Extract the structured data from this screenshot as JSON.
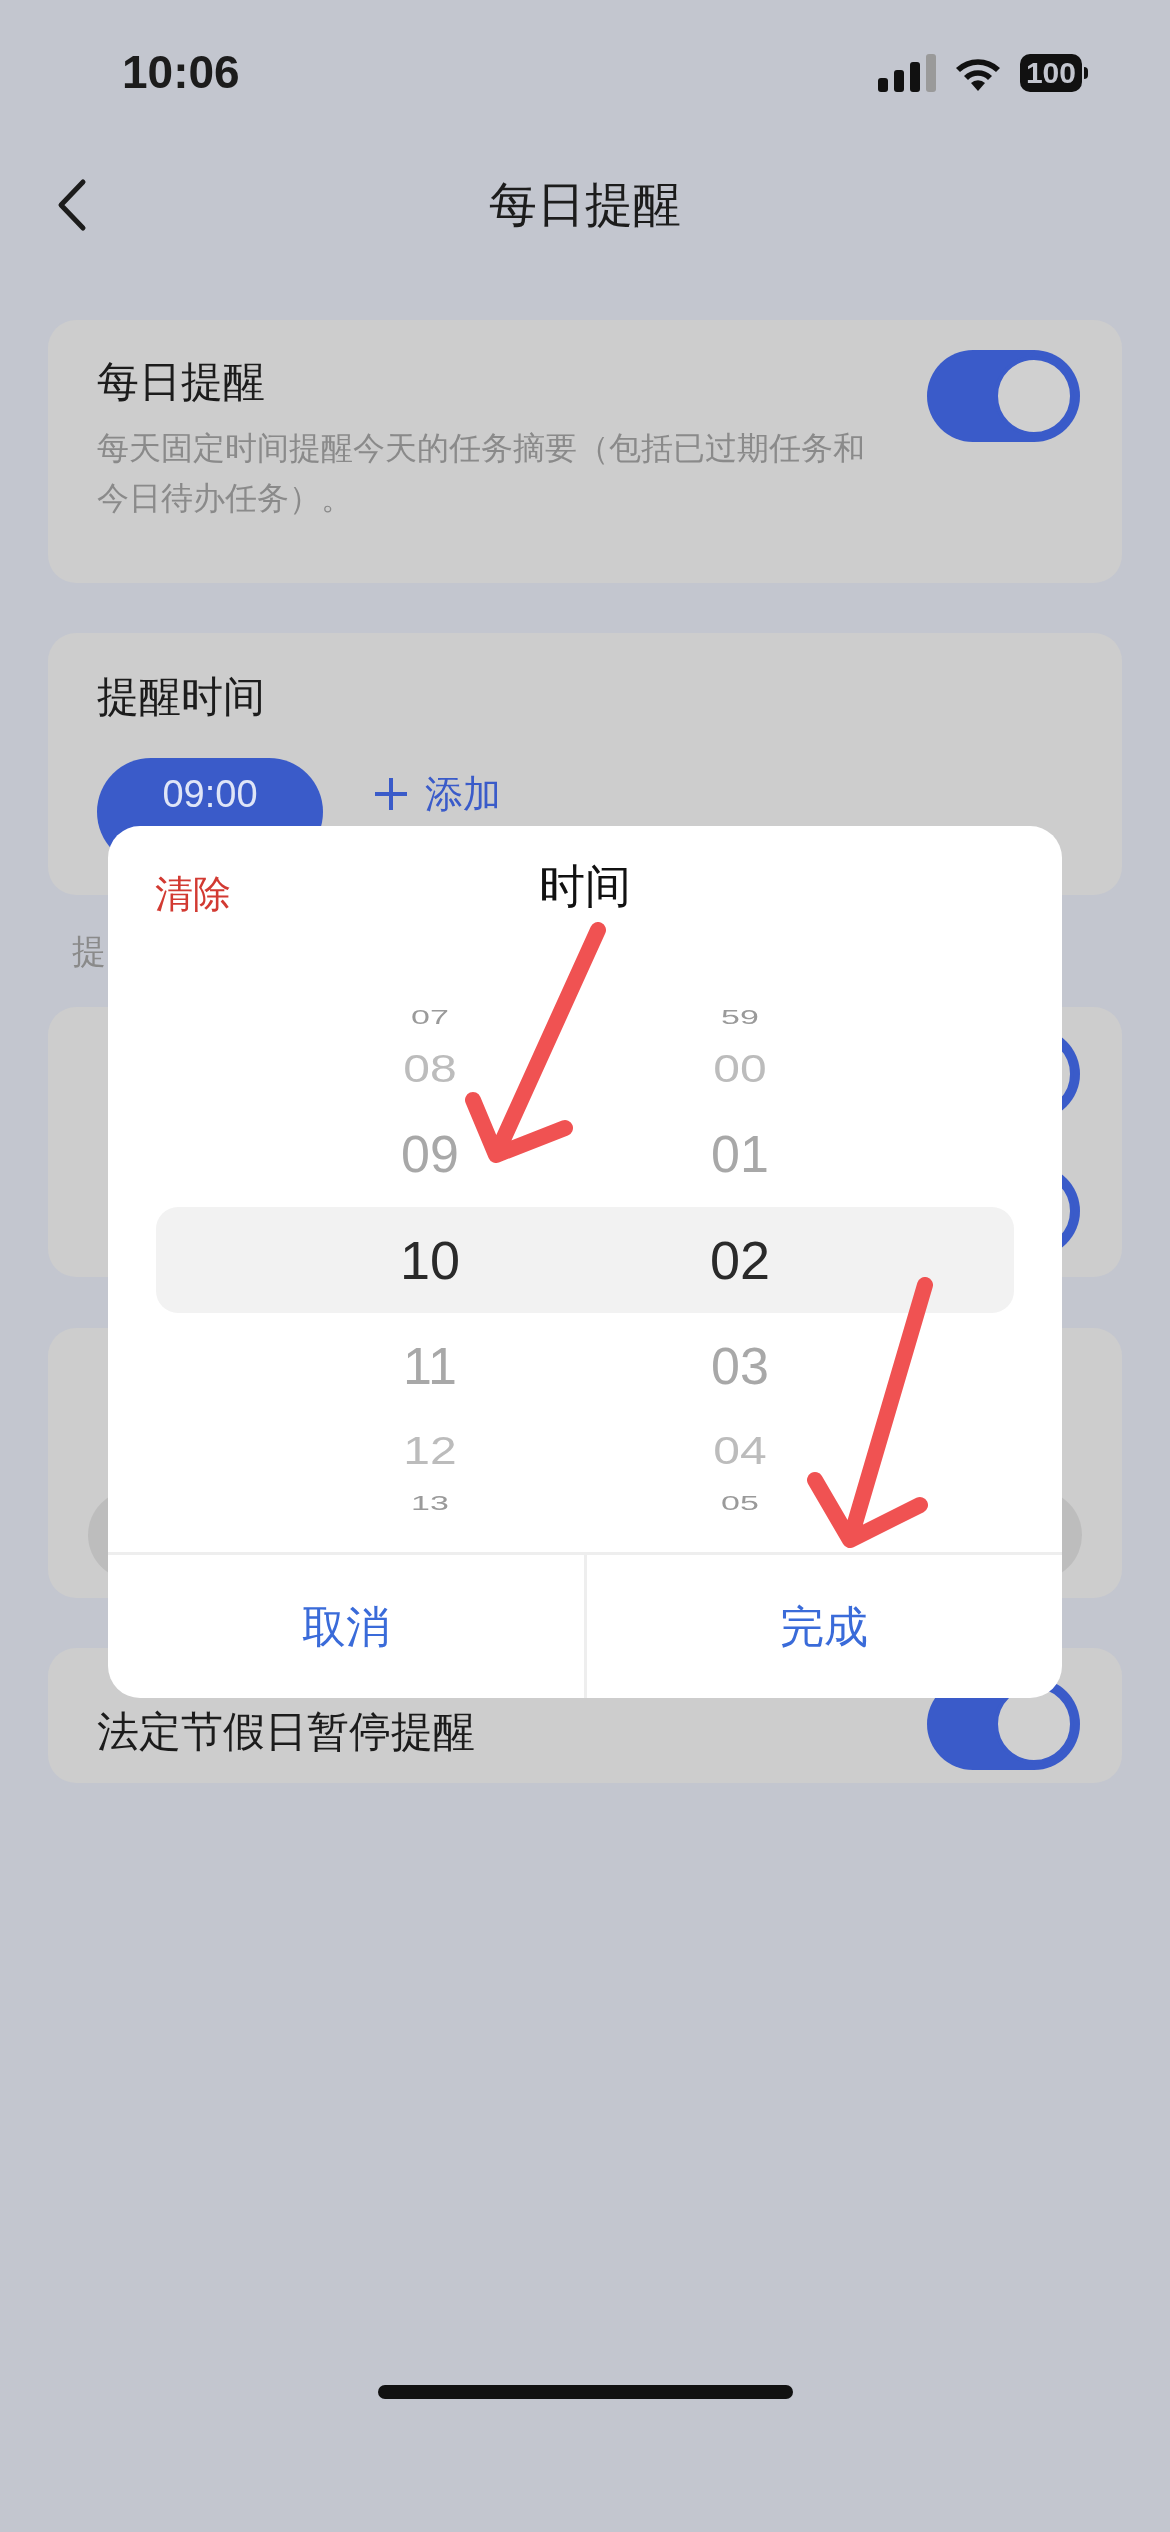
{
  "status_bar": {
    "time": "10:06",
    "battery": "100"
  },
  "header": {
    "title": "每日提醒"
  },
  "daily_reminder": {
    "title": "每日提醒",
    "description": "每天固定时间提醒今天的任务摘要（包括已过期任务和今日待办任务）。",
    "on": true
  },
  "reminder_time": {
    "title": "提醒时间",
    "times": [
      {
        "label": "09:00"
      }
    ],
    "add_label": "添加"
  },
  "section_label": "提",
  "covered_toggles": [
    {
      "on": true
    },
    {
      "on": true
    }
  ],
  "holiday": {
    "label": "法定节假日暂停提醒",
    "on": true
  },
  "time_picker": {
    "title": "时间",
    "clear": "清除",
    "hours": [
      {
        "label": "07",
        "selected": false
      },
      {
        "label": "08",
        "selected": false
      },
      {
        "label": "09",
        "selected": false
      },
      {
        "label": "10",
        "selected": true
      },
      {
        "label": "11",
        "selected": false
      },
      {
        "label": "12",
        "selected": false
      },
      {
        "label": "13",
        "selected": false
      }
    ],
    "minutes": [
      {
        "label": "59",
        "selected": false
      },
      {
        "label": "00",
        "selected": false
      },
      {
        "label": "01",
        "selected": false
      },
      {
        "label": "02",
        "selected": true
      },
      {
        "label": "03",
        "selected": false
      },
      {
        "label": "04",
        "selected": false
      },
      {
        "label": "05",
        "selected": false
      }
    ],
    "buttons": [
      {
        "label": "取消"
      },
      {
        "label": "完成"
      }
    ]
  }
}
